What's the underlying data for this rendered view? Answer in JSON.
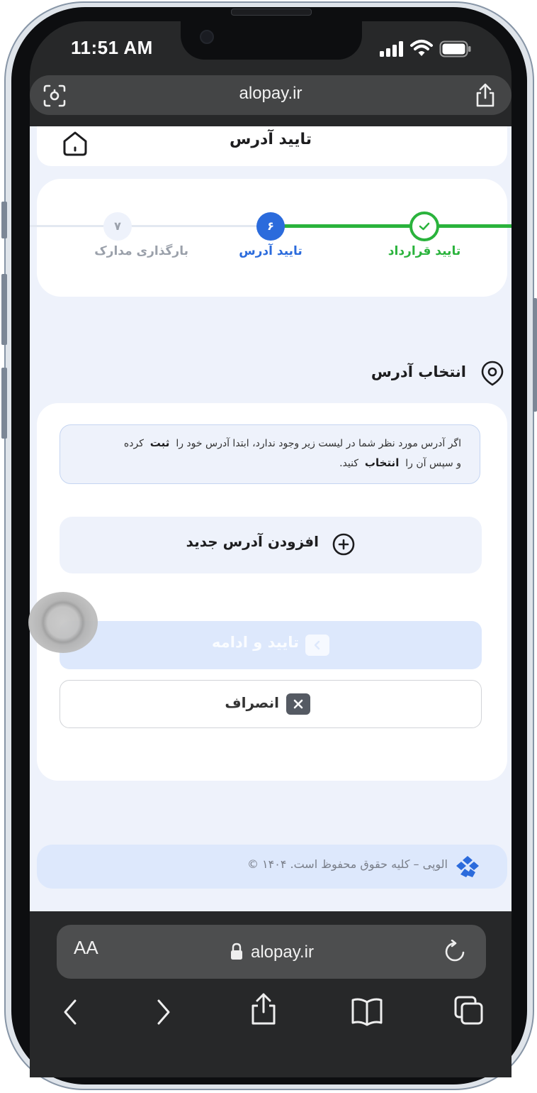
{
  "status_bar": {
    "time": "11:51 AM"
  },
  "browser_top": {
    "domain": "alopay.ir"
  },
  "page": {
    "title": "تایید آدرس",
    "stepper": {
      "steps": [
        {
          "label": "تایید قرارداد",
          "state": "done"
        },
        {
          "label": "تایید آدرس",
          "number": "۶",
          "state": "active"
        },
        {
          "label": "بارگذاری مدارک",
          "number": "۷",
          "state": "pending"
        }
      ]
    },
    "section_title": "انتخاب آدرس",
    "info": {
      "part1": "اگر آدرس مورد نظر شما در لیست زیر وجود ندارد، ابتدا آدرس خود را",
      "bold1": "ثبت",
      "part2": "کرده",
      "part3": "و سپس آن را",
      "bold2": "انتخاب",
      "part4": "کنید."
    },
    "add_address_label": "افزودن آدرس جدید",
    "confirm_label": "تایید و ادامه",
    "cancel_label": "انصراف",
    "footer_text": "© الوپی – کلیه حقوق محفوظ است. ۱۴۰۴"
  },
  "browser_bottom": {
    "text_size_label": "AA",
    "domain": "alopay.ir"
  },
  "colors": {
    "done_green": "#2ab33c",
    "active_blue": "#2b6bdc",
    "pending_gray": "#9aa0aa",
    "page_bg": "#eef2fb",
    "chip_blue": "#dde8fc"
  },
  "icons": [
    "home-icon",
    "check-icon",
    "location-pin-icon",
    "plus-circle-icon",
    "chevron-left-icon",
    "close-icon",
    "alopay-logo-icon",
    "lock-icon",
    "reload-icon",
    "share-icon",
    "bookmarks-icon",
    "tabs-icon",
    "scan-icon",
    "wifi-icon",
    "signal-icon",
    "battery-icon"
  ]
}
